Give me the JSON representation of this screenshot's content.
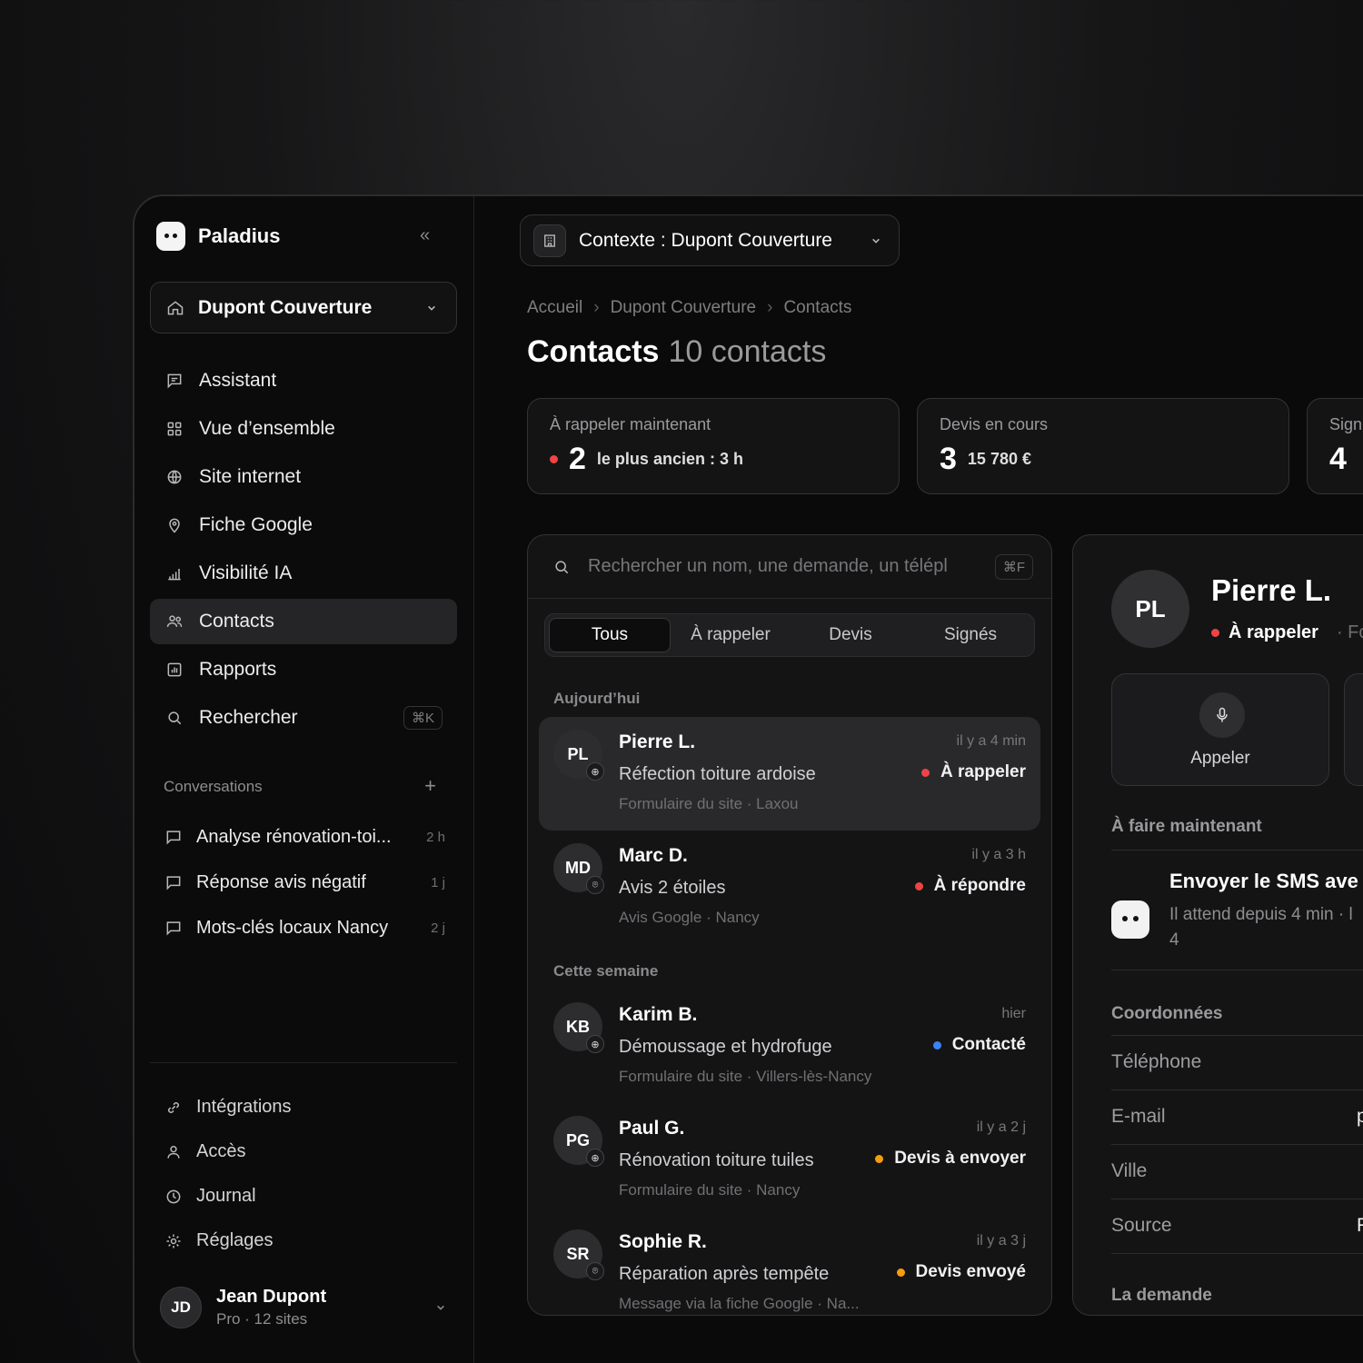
{
  "app": {
    "name": "Paladius"
  },
  "sidebar": {
    "workspace": "Dupont Couverture",
    "items": [
      {
        "label": "Assistant",
        "icon": "chat-icon"
      },
      {
        "label": "Vue d’ensemble",
        "icon": "grid-icon"
      },
      {
        "label": "Site internet",
        "icon": "globe-icon"
      },
      {
        "label": "Fiche Google",
        "icon": "map-pin-icon"
      },
      {
        "label": "Visibilité IA",
        "icon": "bar-chart-icon"
      },
      {
        "label": "Contacts",
        "icon": "users-icon",
        "active": true
      },
      {
        "label": "Rapports",
        "icon": "report-icon"
      },
      {
        "label": "Rechercher",
        "icon": "search-icon",
        "shortcut": "⌘K"
      }
    ],
    "conversations_title": "Conversations",
    "conversations": [
      {
        "title": "Analyse rénovation-toi...",
        "time": "2 h"
      },
      {
        "title": "Réponse avis négatif",
        "time": "1 j"
      },
      {
        "title": "Mots-clés locaux Nancy",
        "time": "2 j"
      }
    ],
    "bottom": [
      {
        "label": "Intégrations",
        "icon": "link-icon"
      },
      {
        "label": "Accès",
        "icon": "user-icon"
      },
      {
        "label": "Journal",
        "icon": "clock-icon"
      },
      {
        "label": "Réglages",
        "icon": "gear-icon"
      }
    ],
    "user": {
      "initials": "JD",
      "name": "Jean Dupont",
      "plan": "Pro · 12 sites"
    }
  },
  "header": {
    "context": "Contexte : Dupont Couverture",
    "breadcrumb": [
      "Accueil",
      "Dupont Couverture",
      "Contacts"
    ],
    "title": "Contacts",
    "count": "10 contacts"
  },
  "stats": [
    {
      "label": "À rappeler maintenant",
      "value": "2",
      "sub": "le plus ancien : 3 h",
      "status_color": "#ef4444"
    },
    {
      "label": "Devis en cours",
      "value": "3",
      "sub": "15 780 €"
    },
    {
      "label": "Sign",
      "value": "4",
      "sub": ""
    }
  ],
  "list": {
    "search_placeholder": "Rechercher un nom, une demande, un télépl",
    "search_shortcut": "⌘F",
    "tabs": [
      "Tous",
      "À rappeler",
      "Devis",
      "Signés"
    ],
    "groups": [
      "Aujourd’hui",
      "Cette semaine"
    ],
    "contacts": [
      {
        "initials": "PL",
        "name": "Pierre L.",
        "request": "Réfection toiture ardoise",
        "source": "Formulaire du site · Laxou",
        "time": "il y a 4 min",
        "status": "À rappeler",
        "status_color": "#ef4444",
        "badge": "globe-icon"
      },
      {
        "initials": "MD",
        "name": "Marc D.",
        "request": "Avis 2 étoiles",
        "source": "Avis Google · Nancy",
        "time": "il y a 3 h",
        "status": "À répondre",
        "status_color": "#ef4444",
        "badge": "map-pin-icon"
      },
      {
        "initials": "KB",
        "name": "Karim B.",
        "request": "Démoussage et hydrofuge",
        "source": "Formulaire du site · Villers-lès-Nancy",
        "time": "hier",
        "status": "Contacté",
        "status_color": "#3b82f6",
        "badge": "globe-icon"
      },
      {
        "initials": "PG",
        "name": "Paul G.",
        "request": "Rénovation toiture tuiles",
        "source": "Formulaire du site · Nancy",
        "time": "il y a 2 j",
        "status": "Devis à envoyer",
        "status_color": "#f59e0b",
        "badge": "globe-icon"
      },
      {
        "initials": "SR",
        "name": "Sophie R.",
        "request": "Réparation après tempête",
        "source": "Message via la fiche Google · Na...",
        "time": "il y a 3 j",
        "status": "Devis envoyé",
        "status_color": "#f59e0b",
        "badge": "map-pin-icon"
      }
    ]
  },
  "detail": {
    "initials": "PL",
    "name": "Pierre L.",
    "status": "À rappeler",
    "status_extra": "·  Fo",
    "action_call": "Appeler",
    "todo_title": "À faire maintenant",
    "todo_item": "Envoyer le SMS ave",
    "todo_sub": "Il attend depuis 4 min · l",
    "todo_sub2": "4",
    "coords_title": "Coordonnées",
    "fields": [
      {
        "label": "Téléphone",
        "value": ""
      },
      {
        "label": "E-mail",
        "value": "p"
      },
      {
        "label": "Ville",
        "value": ""
      },
      {
        "label": "Source",
        "value": "F"
      }
    ],
    "request_title": "La demande"
  }
}
